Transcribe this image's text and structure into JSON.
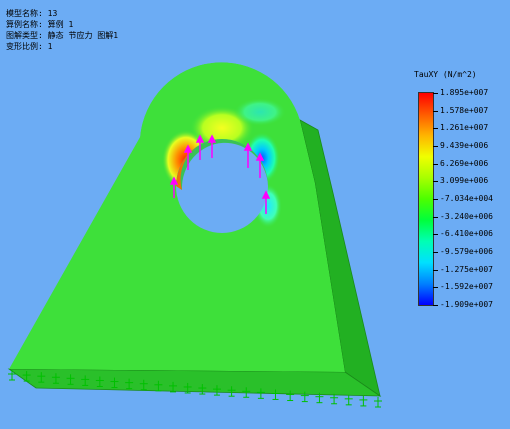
{
  "info": {
    "line1": "模型名称: 13",
    "line2": "算例名称: 算例 1",
    "line3": "图解类型: 静态 节应力 图解1",
    "line4": "变形比例: 1"
  },
  "legend": {
    "title": "TauXY (N/m^2)",
    "labels": [
      "1.895e+007",
      "1.578e+007",
      "1.261e+007",
      "9.439e+006",
      "6.269e+006",
      "3.099e+006",
      "-7.034e+004",
      "-3.240e+006",
      "-6.410e+006",
      "-9.579e+006",
      "-1.275e+007",
      "-1.592e+007",
      "-1.909e+007"
    ]
  },
  "colors": {
    "background": "#6cacf4",
    "plate_main": "#3ee03a",
    "plate_side": "#22b022",
    "arrows": "#ff00ff",
    "fixtures": "#00d000"
  }
}
